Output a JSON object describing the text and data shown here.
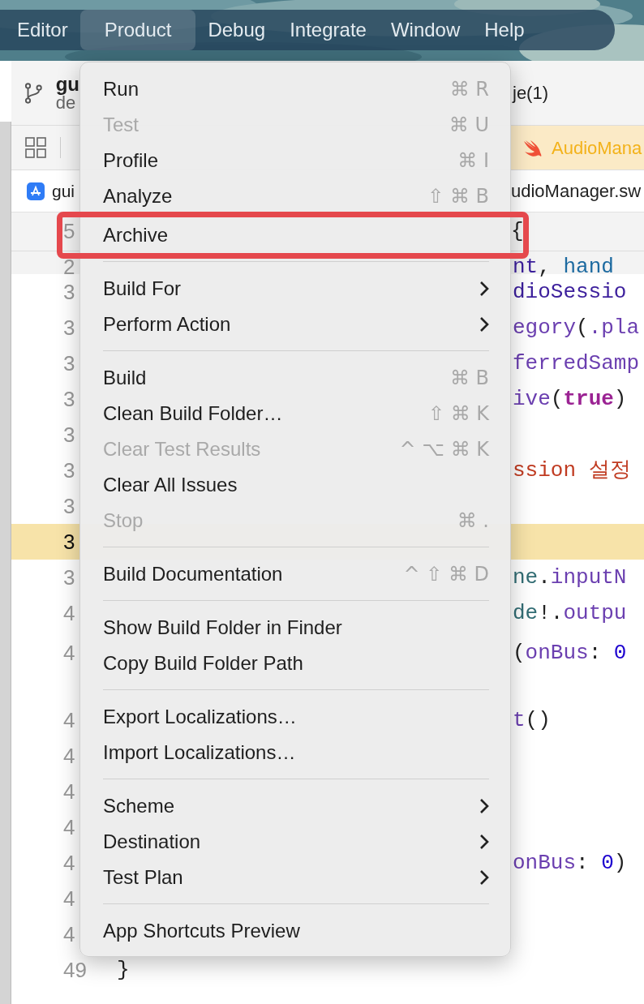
{
  "menubar": {
    "items": [
      {
        "label": "Editor",
        "selected": false
      },
      {
        "label": "Product",
        "selected": true
      },
      {
        "label": "Debug",
        "selected": false
      },
      {
        "label": "Integrate",
        "selected": false
      },
      {
        "label": "Window",
        "selected": false
      },
      {
        "label": "Help",
        "selected": false
      }
    ]
  },
  "toolbar": {
    "branch_title": "gu",
    "branch_subtitle": "de",
    "tab_title": "je(1)"
  },
  "tab_bar": {
    "active_tab": "AudioMana"
  },
  "jump_bar": {
    "project": "gui",
    "file": "udioManager.sw"
  },
  "sticky_header": {
    "number": "5",
    "code": "{"
  },
  "code_lines": [
    {
      "number": "2",
      "current": false,
      "code": [
        {
          "text": "nt",
          "kind": "type"
        },
        {
          "text": ", ",
          "kind": "plain"
        },
        {
          "text": "hand",
          "kind": "param"
        }
      ]
    },
    {
      "number": "3",
      "current": false,
      "code": [
        {
          "text": "dioSessio",
          "kind": "type"
        }
      ]
    },
    {
      "number": "3",
      "current": false,
      "code": [
        {
          "text": "egory",
          "kind": "func"
        },
        {
          "text": "(",
          "kind": "plain"
        },
        {
          "text": ".pla",
          "kind": "func"
        }
      ]
    },
    {
      "number": "3",
      "current": false,
      "code": [
        {
          "text": "ferredSamp",
          "kind": "func"
        }
      ]
    },
    {
      "number": "3",
      "current": false,
      "code": [
        {
          "text": "ive",
          "kind": "func"
        },
        {
          "text": "(",
          "kind": "plain"
        },
        {
          "text": "true",
          "kind": "keyword"
        },
        {
          "text": ")",
          "kind": "plain"
        }
      ]
    },
    {
      "number": "3",
      "current": false
    },
    {
      "number": "3",
      "current": false,
      "code": [
        {
          "text": "ssion 설정",
          "kind": "comment"
        }
      ]
    },
    {
      "number": "3",
      "current": false
    },
    {
      "number": "3",
      "current": true
    },
    {
      "number": "3",
      "current": false,
      "code": [
        {
          "text": "ne",
          "kind": "var"
        },
        {
          "text": ".",
          "kind": "plain"
        },
        {
          "text": "inputN",
          "kind": "func"
        }
      ]
    },
    {
      "number": "4",
      "current": false,
      "code": [
        {
          "text": "de",
          "kind": "var"
        },
        {
          "text": "!.",
          "kind": "plain"
        },
        {
          "text": "outpu",
          "kind": "func"
        }
      ]
    },
    {
      "number": "4",
      "current": false,
      "code": [
        {
          "text": "(",
          "kind": "plain"
        },
        {
          "text": "onBus",
          "kind": "func"
        },
        {
          "text": ": ",
          "kind": "plain"
        },
        {
          "text": "0",
          "kind": "number"
        }
      ]
    },
    {
      "number": "4",
      "current": false,
      "code": [
        {
          "text": "t",
          "kind": "func"
        },
        {
          "text": "()",
          "kind": "plain"
        }
      ]
    },
    {
      "number": "4",
      "current": false
    },
    {
      "number": "4",
      "current": false
    },
    {
      "number": "4",
      "current": false
    },
    {
      "number": "4",
      "current": false,
      "code": [
        {
          "text": "onBus",
          "kind": "func"
        },
        {
          "text": ": ",
          "kind": "plain"
        },
        {
          "text": "0",
          "kind": "number"
        },
        {
          "text": ")",
          "kind": "plain"
        }
      ]
    },
    {
      "number": "4",
      "current": false
    },
    {
      "number": "4",
      "current": false
    },
    {
      "number": "49",
      "current": false,
      "left_code": "}"
    }
  ],
  "menu": {
    "items": [
      {
        "kind": "item",
        "label": "Run",
        "shortcut": "⌘ R",
        "disabled": false,
        "highlighted": false
      },
      {
        "kind": "item",
        "label": "Test",
        "shortcut": "⌘ U",
        "disabled": true,
        "highlighted": false
      },
      {
        "kind": "item",
        "label": "Profile",
        "shortcut": "⌘ I",
        "disabled": false,
        "highlighted": false
      },
      {
        "kind": "item",
        "label": "Analyze",
        "shortcut": "⇧ ⌘ B",
        "disabled": false,
        "highlighted": false
      },
      {
        "kind": "item",
        "label": "Archive",
        "disabled": false,
        "highlighted": true
      },
      {
        "kind": "separator"
      },
      {
        "kind": "submenu",
        "label": "Build For",
        "disabled": false,
        "highlighted": false
      },
      {
        "kind": "submenu",
        "label": "Perform Action",
        "disabled": false,
        "highlighted": false
      },
      {
        "kind": "separator"
      },
      {
        "kind": "item",
        "label": "Build",
        "shortcut": "⌘ B",
        "disabled": false,
        "highlighted": false
      },
      {
        "kind": "item",
        "label": "Clean Build Folder…",
        "shortcut": "⇧ ⌘ K",
        "disabled": false,
        "highlighted": false
      },
      {
        "kind": "item",
        "label": "Clear Test Results",
        "shortcut": "^ ⌥ ⌘ K",
        "disabled": true,
        "highlighted": false
      },
      {
        "kind": "item",
        "label": "Clear All Issues",
        "disabled": false,
        "highlighted": false
      },
      {
        "kind": "item",
        "label": "Stop",
        "shortcut": "⌘ .",
        "disabled": true,
        "highlighted": false
      },
      {
        "kind": "separator"
      },
      {
        "kind": "item",
        "label": "Build Documentation",
        "shortcut": "^ ⇧ ⌘ D",
        "disabled": false,
        "highlighted": false
      },
      {
        "kind": "separator"
      },
      {
        "kind": "item",
        "label": "Show Build Folder in Finder",
        "disabled": false,
        "highlighted": false
      },
      {
        "kind": "item",
        "label": "Copy Build Folder Path",
        "disabled": false,
        "highlighted": false
      },
      {
        "kind": "separator"
      },
      {
        "kind": "item",
        "label": "Export Localizations…",
        "disabled": false,
        "highlighted": false
      },
      {
        "kind": "item",
        "label": "Import Localizations…",
        "disabled": false,
        "highlighted": false
      },
      {
        "kind": "separator"
      },
      {
        "kind": "submenu",
        "label": "Scheme",
        "disabled": false,
        "highlighted": false
      },
      {
        "kind": "submenu",
        "label": "Destination",
        "disabled": false,
        "highlighted": false
      },
      {
        "kind": "submenu",
        "label": "Test Plan",
        "disabled": false,
        "highlighted": false
      },
      {
        "kind": "separator"
      },
      {
        "kind": "item",
        "label": "App Shortcuts Preview",
        "disabled": false,
        "highlighted": false
      }
    ]
  }
}
